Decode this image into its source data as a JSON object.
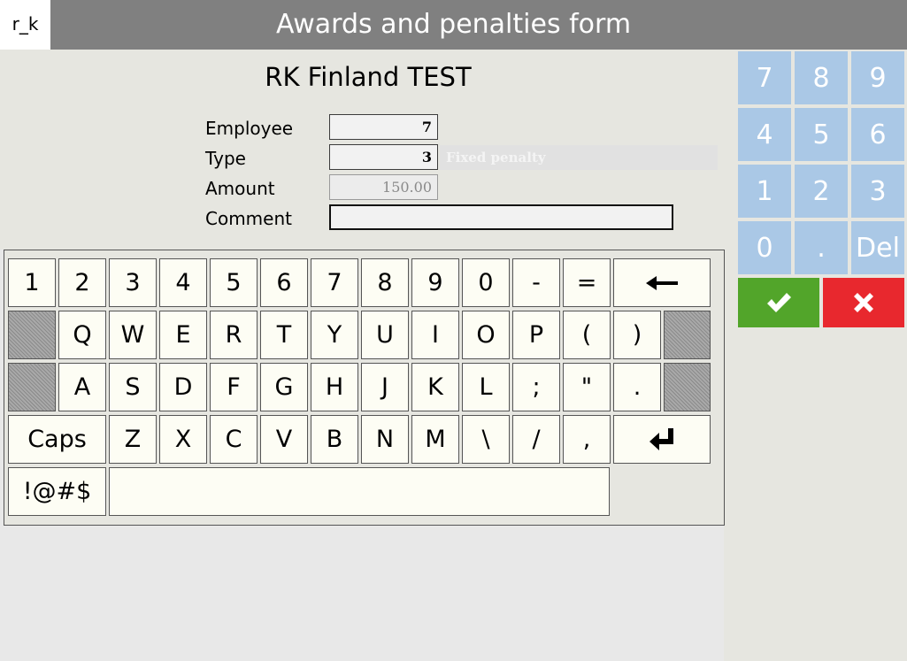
{
  "header": {
    "logo_text": "r_k",
    "title": "Awards and penalties form"
  },
  "form": {
    "company_name": "RK Finland TEST",
    "labels": {
      "employee": "Employee",
      "type": "Type",
      "amount": "Amount",
      "comment": "Comment"
    },
    "values": {
      "employee": "7",
      "type": "3",
      "type_description": "Fixed penalty",
      "amount": "150.00",
      "comment": ""
    }
  },
  "keyboard": {
    "row1": [
      "1",
      "2",
      "3",
      "4",
      "5",
      "6",
      "7",
      "8",
      "9",
      "0",
      "-",
      "="
    ],
    "row2": [
      "Q",
      "W",
      "E",
      "R",
      "T",
      "Y",
      "U",
      "I",
      "O",
      "P",
      "(",
      ")"
    ],
    "row3": [
      "A",
      "S",
      "D",
      "F",
      "G",
      "H",
      "J",
      "K",
      "L",
      ";",
      "\"",
      "."
    ],
    "row4": [
      "Z",
      "X",
      "C",
      "V",
      "B",
      "N",
      "M",
      "\\",
      "/",
      ","
    ],
    "caps_label": "Caps",
    "symbols_label": "!@#$",
    "space_label": ""
  },
  "numpad": {
    "keys": [
      "7",
      "8",
      "9",
      "4",
      "5",
      "6",
      "1",
      "2",
      "3",
      "0",
      ".",
      "Del"
    ],
    "ok_icon": "check-icon",
    "cancel_icon": "close-icon"
  },
  "colors": {
    "titlebar": "#808080",
    "numpad_key": "#aac8e6",
    "ok_button": "#52a52a",
    "cancel_button": "#e8282e"
  }
}
